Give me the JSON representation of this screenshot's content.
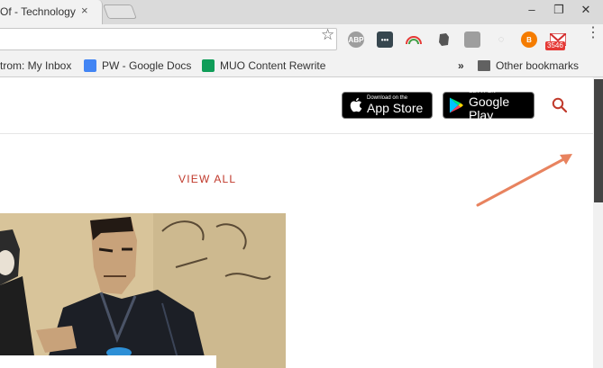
{
  "browser": {
    "tab_title": "Of - Technology",
    "tab_close": "×",
    "window_minimize": "–",
    "window_restore": "❐",
    "window_close": "✕",
    "star_glyph": "☆",
    "extensions": {
      "abp_label": "ABP",
      "mail_badge": "3546"
    },
    "menu_dots": "⋮"
  },
  "bookmarks": {
    "items": [
      {
        "label": "trom: My Inbox"
      },
      {
        "label": "PW - Google Docs"
      },
      {
        "label": "MUO Content Rewrite"
      }
    ],
    "overflow": "»",
    "other": "Other bookmarks"
  },
  "page": {
    "app_store": {
      "small": "Download on the",
      "big": "App Store"
    },
    "google_play": {
      "small": "GET IT ON",
      "big": "Google Play"
    },
    "view_all": "VIEW ALL"
  },
  "colors": {
    "accent_red": "#c0392b",
    "arrow": "#e8835f"
  }
}
